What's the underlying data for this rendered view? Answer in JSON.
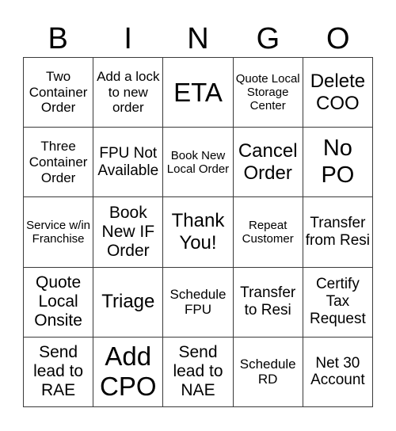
{
  "header": {
    "letters": [
      "B",
      "I",
      "N",
      "G",
      "O"
    ]
  },
  "cells": [
    [
      "Two Container Order",
      "Add a lock to new order",
      "ETA",
      "Quote Local Storage Center",
      "Delete COO"
    ],
    [
      "Three Container Order",
      "FPU Not Available",
      "Book New Local Order",
      "Cancel Order",
      "No PO"
    ],
    [
      "Service w/in Franchise",
      "Book New IF Order",
      "Thank You!",
      "Repeat Customer",
      "Transfer from Resi"
    ],
    [
      "Quote Local Onsite",
      "Triage",
      "Schedule FPU",
      "Transfer to Resi",
      "Certify Tax Request"
    ],
    [
      "Send lead to RAE",
      "Add CPO",
      "Send lead to NAE",
      "Schedule RD",
      "Net 30 Account"
    ]
  ]
}
